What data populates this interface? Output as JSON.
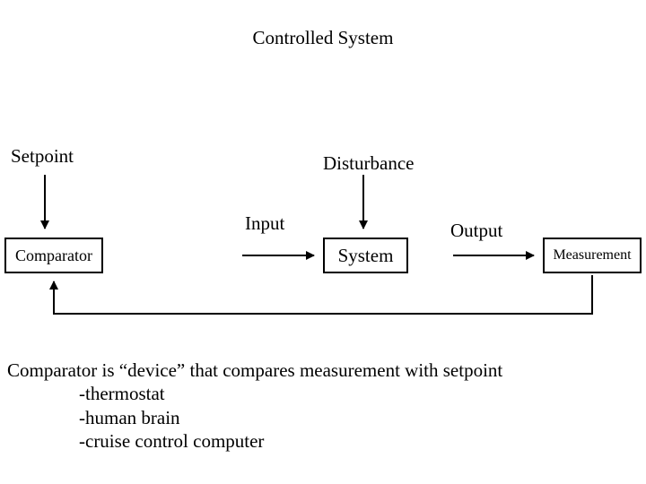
{
  "title": "Controlled System",
  "labels": {
    "setpoint": "Setpoint",
    "disturbance": "Disturbance",
    "input": "Input",
    "output": "Output"
  },
  "boxes": {
    "comparator": "Comparator",
    "system": "System",
    "measurement": "Measurement"
  },
  "description": {
    "line1": "Comparator is “device” that compares measurement with setpoint",
    "bullets": [
      "-thermostat",
      "-human brain",
      "-cruise control computer"
    ]
  }
}
